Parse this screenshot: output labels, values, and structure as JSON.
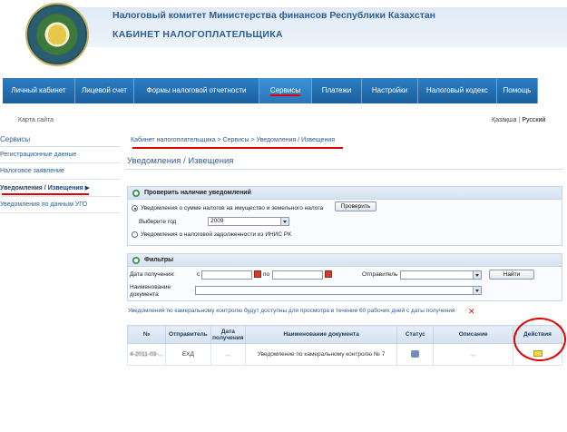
{
  "header": {
    "ministry_title": "Налоговый комитет Министерства финансов Республики Казахстан",
    "cabinet_title": "КАБИНЕТ НАЛОГОПЛАТЕЛЬЩИКА"
  },
  "nav": {
    "items": [
      {
        "label": "Личный кабинет"
      },
      {
        "label": "Лицевой счет"
      },
      {
        "label": "Формы налоговой отчетности"
      },
      {
        "label": "Сервисы"
      },
      {
        "label": "Платежи"
      },
      {
        "label": "Настройки"
      },
      {
        "label": "Налоговый кодекс"
      },
      {
        "label": "Помощь"
      }
    ],
    "active": "Сервисы"
  },
  "top": {
    "sitemap": "Карта сайта",
    "lang_kz": "Қазақша",
    "lang_sep": "|",
    "lang_ru": "Русский"
  },
  "sidebar": {
    "title": "Сервисы",
    "items": [
      {
        "label": "Регистрационные данные"
      },
      {
        "label": "Налоговое заявление"
      },
      {
        "label": "Уведомления / Извещения ▶"
      },
      {
        "label": "Уведомления по данным УГО"
      }
    ]
  },
  "main": {
    "breadcrumb": "Кабинет налогоплательщика > Сервисы > Уведомления / Извещения",
    "page_title": "Уведомления / Извещения"
  },
  "check_panel": {
    "title": "Проверить наличие уведомлений",
    "option1": "Уведомления о сумме налогов на имущество и земельного налога",
    "check_button": "Проверить",
    "year_label": "Выберите год",
    "year_value": "2009",
    "option2": "Уведомления о налоговой задолженности из ИНИС РК"
  },
  "filters": {
    "title": "Фильтры",
    "date_label": "Дата получения:",
    "from_label": "с",
    "to_label": "по",
    "sender_label": "Отправитель",
    "find_button": "Найти",
    "doc_name_label_1": "Наименование",
    "doc_name_label_2": "документа"
  },
  "notice": "Уведомления по камеральному контролю будут доступны для просмотра в течение 60 рабочих дней с даты получения",
  "table": {
    "headers": [
      "№",
      "Отправитель",
      "Дата получения",
      "Наименование документа",
      "Статус",
      "Описание",
      "Действия"
    ],
    "rows": [
      {
        "num": "4-2011-03-...",
        "sender": "ЕХД",
        "date": "...",
        "doc_name": "Уведомление по камеральному контролю № 7",
        "description": "..."
      }
    ]
  },
  "icons": {
    "status": "document-status-icon",
    "action": "envelope-icon",
    "close": "close-icon"
  },
  "colors": {
    "nav_bg": "#1f6aab",
    "title_blue": "#2e5e97",
    "annotation_red": "#e00000"
  }
}
